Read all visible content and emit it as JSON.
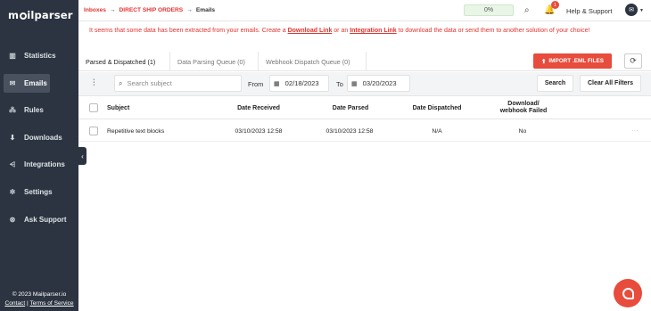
{
  "sidebar": {
    "logo": {
      "pre": "m",
      "o": "",
      "post": "ilparser"
    },
    "items": [
      {
        "label": "Statistics",
        "icon": "bar-chart-icon",
        "glyph": "▥"
      },
      {
        "label": "Emails",
        "icon": "envelope-icon",
        "glyph": "✉"
      },
      {
        "label": "Rules",
        "icon": "sitemap-icon",
        "glyph": "⁂"
      },
      {
        "label": "Downloads",
        "icon": "download-icon",
        "glyph": "⬇"
      },
      {
        "label": "Integrations",
        "icon": "share-icon",
        "glyph": "⩤"
      },
      {
        "label": "Settings",
        "icon": "gear-icon",
        "glyph": "✲"
      },
      {
        "label": "Ask Support",
        "icon": "lifebuoy-icon",
        "glyph": "⊛"
      }
    ],
    "footer_copy": "© 2023 Mailparser.io",
    "contact": "Contact",
    "sep": "|",
    "terms": "Terms of Service",
    "collapse_glyph": "‹"
  },
  "topbar": {
    "crumb_inboxes": "Inboxes",
    "crumb_arrow1": "→",
    "crumb_inbox": "DIRECT SHIP ORDERS",
    "crumb_arrow2": "→",
    "crumb_current": "Emails",
    "progress": "0%",
    "search_glyph": "⌕",
    "bell_glyph": "🔔",
    "notifications": "1",
    "help": "Help & Support",
    "avatar_glyph": "✉",
    "caret": "▼"
  },
  "notice": {
    "part1": "It seems that some data has been extracted from your emails. Create a ",
    "link1": "Download Link",
    "part2": " or an ",
    "link2": "Integration Link",
    "part3": " to download the data or send them to another solution of your choice!"
  },
  "tabs": [
    {
      "label": "Parsed & Dispatched (1)"
    },
    {
      "label": "Data Parsing Queue (0)"
    },
    {
      "label": "Webhook Dispatch Queue (0)"
    }
  ],
  "import_button": "IMPORT .EML FILES",
  "import_glyph": "⬆",
  "refresh_glyph": "⟳",
  "filters": {
    "toggle_glyph": "⫶",
    "search_placeholder": "Search subject",
    "from_label": "From",
    "from_date": "02/18/2023",
    "to_label": "To",
    "to_date": "03/20/2023",
    "calendar_glyph": "▦",
    "search_button": "Search",
    "clear_button": "Clear All Filters"
  },
  "table": {
    "headers": {
      "subject": "Subject",
      "received": "Date Received",
      "parsed": "Date Parsed",
      "dispatched": "Date Dispatched",
      "failed_1": "Download/",
      "failed_2": "webhook Failed"
    },
    "rows": [
      {
        "subject": "Repetitive text blocks",
        "received": "03/10/2023 12:58",
        "parsed": "03/10/2023 12:58",
        "dispatched": "N/A",
        "failed": "No",
        "more": "⋯"
      }
    ]
  },
  "colors": {
    "accent": "#e74c3c",
    "sidebar": "#2b3440"
  }
}
